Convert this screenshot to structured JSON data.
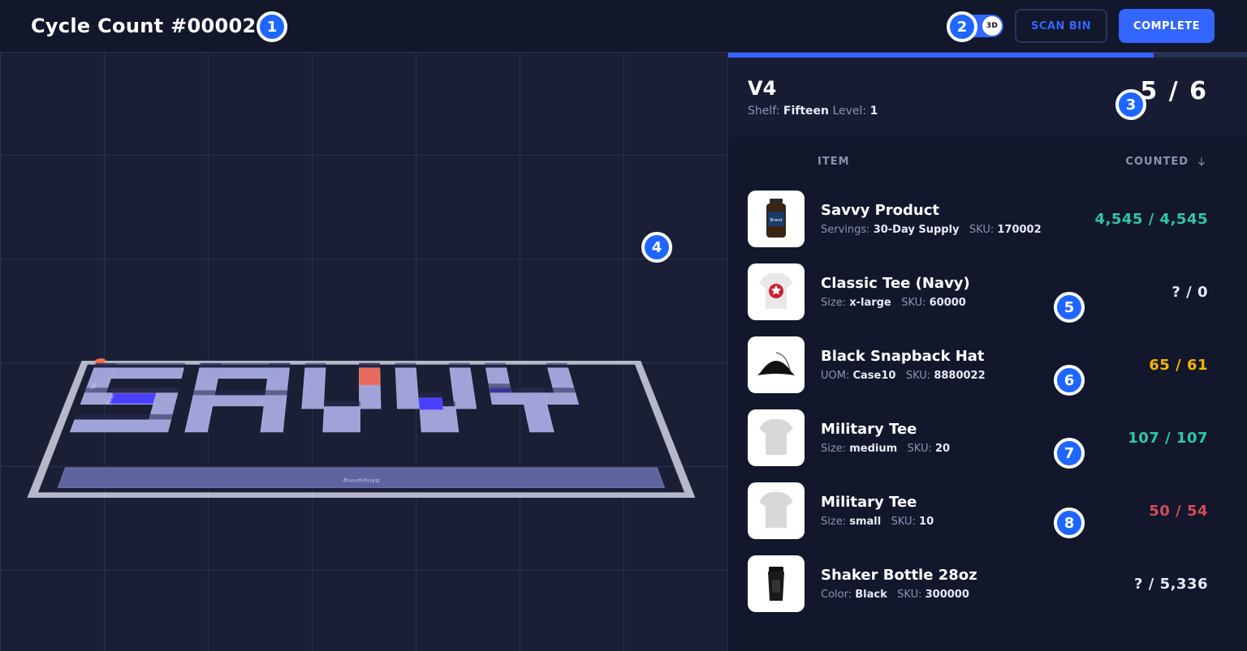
{
  "header": {
    "title": "Cycle Count #00002",
    "toggle_label": "3D",
    "scan_label": "SCAN BIN",
    "complete_label": "COMPLETE"
  },
  "bin": {
    "name": "V4",
    "shelf_label": "Shelf:",
    "shelf_value": "Fifteen",
    "level_label": "Level:",
    "level_value": "1",
    "counted": "5",
    "total": "6",
    "progress_pct": 82
  },
  "table_head": {
    "item": "ITEM",
    "counted": "COUNTED"
  },
  "warehouse": {
    "shipping_label": "Shipping",
    "label_two": "Two",
    "label_three": "Three"
  },
  "items": [
    {
      "name": "Savvy Product",
      "attr1_label": "Servings:",
      "attr1_value": "30-Day Supply",
      "sku_label": "SKU:",
      "sku_value": "170002",
      "count_text": "4,545 / 4,545",
      "count_class": "green",
      "thumb": "bottle"
    },
    {
      "name": "Classic Tee (Navy)",
      "attr1_label": "Size:",
      "attr1_value": "x-large",
      "sku_label": "SKU:",
      "sku_value": "60000",
      "count_text": "? / 0",
      "count_class": "plain",
      "thumb": "tee-navy"
    },
    {
      "name": "Black Snapback Hat",
      "attr1_label": "UOM:",
      "attr1_value": "Case10",
      "sku_label": "SKU:",
      "sku_value": "8880022",
      "count_text": "65 / 61",
      "count_class": "yellow",
      "thumb": "hat"
    },
    {
      "name": "Military Tee",
      "attr1_label": "Size:",
      "attr1_value": "medium",
      "sku_label": "SKU:",
      "sku_value": "20",
      "count_text": "107 / 107",
      "count_class": "green",
      "thumb": "tee-grey"
    },
    {
      "name": "Military Tee",
      "attr1_label": "Size:",
      "attr1_value": "small",
      "sku_label": "SKU:",
      "sku_value": "10",
      "count_text": "50 / 54",
      "count_class": "red",
      "thumb": "tee-grey"
    },
    {
      "name": "Shaker Bottle 28oz",
      "attr1_label": "Color:",
      "attr1_value": "Black",
      "sku_label": "SKU:",
      "sku_value": "300000",
      "count_text": "? / 5,336",
      "count_class": "plain",
      "thumb": "shaker"
    }
  ],
  "steps": {
    "1": "1",
    "2": "2",
    "3": "3",
    "4": "4",
    "5": "5",
    "6": "6",
    "7": "7",
    "8": "8"
  }
}
